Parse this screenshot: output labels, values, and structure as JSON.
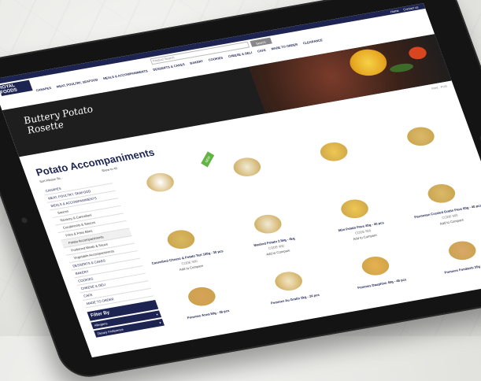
{
  "header": {
    "top_links": [
      "Home",
      "Contact us"
    ],
    "search": {
      "placeholder": "Product Search",
      "button": "Search"
    },
    "logo": "ROYAL FOODS",
    "nav": [
      "CANAPES",
      "MEAT, POULTRY, SEAFOOD",
      "MEALS & ACCOMPANIMENTS",
      "DESSERTS & CAKES",
      "BAKERY",
      "COOKIES",
      "CHEESE & DELI",
      "CAFE",
      "MADE TO ORDER",
      "CLEARANCE"
    ]
  },
  "hero": {
    "title": "Buttery Potato Rosette"
  },
  "breadcrumb": "Print · Post",
  "main": {
    "title": "Potato Accompaniments",
    "sort_label": "Sort",
    "sort_value": "Please Se...",
    "show_label": "Show to 40"
  },
  "sidebar": {
    "categories": [
      {
        "label": "CANAPES",
        "type": "top"
      },
      {
        "label": "MEAT, POULTRY, SEAFOOD",
        "type": "top"
      },
      {
        "label": "MEALS & ACCOMPANIMENTS",
        "type": "top"
      },
      {
        "label": "Sauces",
        "type": "sub"
      },
      {
        "label": "Savoury & Cannelloni",
        "type": "sub"
      },
      {
        "label": "Condiments & Sauces",
        "type": "sub"
      },
      {
        "label": "Fries & Fries Bites",
        "type": "sub"
      },
      {
        "label": "Potato Accompaniments",
        "type": "sub"
      },
      {
        "label": "Portioned Meals & Sauce",
        "type": "sub"
      },
      {
        "label": "Vegetable Accompaniments",
        "type": "sub"
      },
      {
        "label": "DESSERTS & CAKES",
        "type": "top"
      },
      {
        "label": "BAKERY",
        "type": "top"
      },
      {
        "label": "COOKIES",
        "type": "top"
      },
      {
        "label": "CHEESE & DELI",
        "type": "top"
      },
      {
        "label": "CAFE",
        "type": "top"
      },
      {
        "label": "MADE TO ORDER",
        "type": "top"
      }
    ],
    "filter_title": "Filter By",
    "filters": [
      "Allergens",
      "Dietary Preference"
    ]
  },
  "products": [
    {
      "name": "",
      "code": "",
      "compare": "",
      "color": "#ffffff",
      "badge": "",
      "row": 1
    },
    {
      "name": "",
      "code": "",
      "compare": "",
      "color": "#f1ead5",
      "badge": "NEW",
      "row": 1
    },
    {
      "name": "",
      "code": "",
      "compare": "",
      "color": "#efc752",
      "badge": "",
      "row": 1
    },
    {
      "name": "",
      "code": "",
      "compare": "",
      "color": "#d9b96b",
      "badge": "",
      "row": 1
    },
    {
      "name": "Cannelloni Cheese & Potato Tart 100g - 30 pcs",
      "code": "CODE 900",
      "compare": "Add to Compare",
      "color": "#d9b860",
      "badge": "",
      "row": 2
    },
    {
      "name": "Mashed Potato 2.5kg - 4kg",
      "code": "CODE 900",
      "compare": "Add to Compare",
      "color": "#f1ead5",
      "badge": "",
      "row": 2
    },
    {
      "name": "Mini Potato Pave 40g - 40 pcs",
      "code": "CODE 900",
      "compare": "Add to Compare",
      "color": "#efc752",
      "badge": "",
      "row": 2
    },
    {
      "name": "Parmesan Crusted Gratin Pave 60g - 40 pcs",
      "code": "CODE 900",
      "compare": "Add to Compare",
      "color": "#d9b96b",
      "badge": "",
      "row": 2
    },
    {
      "name": "Pommes Anna 60g - 48 pcs",
      "code": "",
      "compare": "",
      "color": "#d6a358",
      "badge": "",
      "row": 3
    },
    {
      "name": "Pommes Au Gratin 5kg - 24 pcs",
      "code": "",
      "compare": "",
      "color": "#f3e6c4",
      "badge": "",
      "row": 3
    },
    {
      "name": "Pommes Dauphine 40g - 48 pcs",
      "code": "",
      "compare": "",
      "color": "#e8b14f",
      "badge": "",
      "row": 3
    },
    {
      "name": "Pommes Fondants 35g - 48 pcs",
      "code": "",
      "compare": "",
      "color": "#d8a86a",
      "badge": "",
      "row": 3
    }
  ]
}
